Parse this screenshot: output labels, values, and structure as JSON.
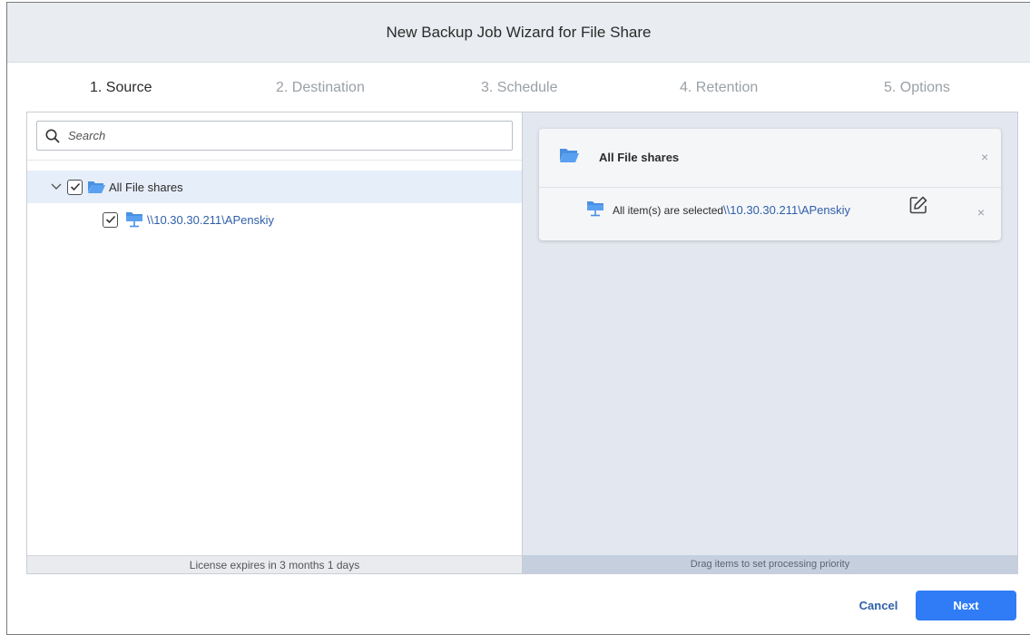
{
  "window": {
    "title": "New Backup Job Wizard for File Share"
  },
  "steps": [
    {
      "label": "1. Source",
      "active": true
    },
    {
      "label": "2. Destination",
      "active": false
    },
    {
      "label": "3. Schedule",
      "active": false
    },
    {
      "label": "4. Retention",
      "active": false
    },
    {
      "label": "5. Options",
      "active": false
    }
  ],
  "search": {
    "placeholder": "Search",
    "value": ""
  },
  "tree": [
    {
      "label": "All File shares",
      "checked": true,
      "expanded": true,
      "icon": "folder-open-icon"
    },
    {
      "label": "\\\\10.30.30.211\\APenskiy",
      "checked": true,
      "icon": "network-share-icon"
    }
  ],
  "left_footer": "License expires in 3 months 1 days",
  "selection_card": {
    "title": "All File shares",
    "item_prefix": "All item(s) are selected",
    "item_path": "\\\\10.30.30.211\\APenskiy",
    "close_glyph": "×"
  },
  "right_footer": "Drag items to set processing priority",
  "buttons": {
    "cancel": "Cancel",
    "next": "Next"
  },
  "colors": {
    "accent": "#2f7cf6",
    "link": "#2f5fa8",
    "folder": "#4a90e2",
    "selected_row": "#e6eef9"
  }
}
